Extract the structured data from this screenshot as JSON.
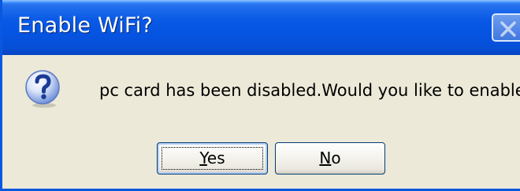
{
  "dialog": {
    "title": "Enable WiFi?",
    "message": "pc card has been disabled.Would you like to enable WiFi?",
    "icon": "question-icon",
    "close_icon": "close-icon"
  },
  "buttons": {
    "yes": {
      "mnemonic": "Y",
      "rest": "es"
    },
    "no": {
      "mnemonic": "N",
      "rest": "o"
    }
  },
  "colors": {
    "titlebar": "#0554e2",
    "dialog_bg": "#ece9d8",
    "border": "#0a58e0"
  }
}
